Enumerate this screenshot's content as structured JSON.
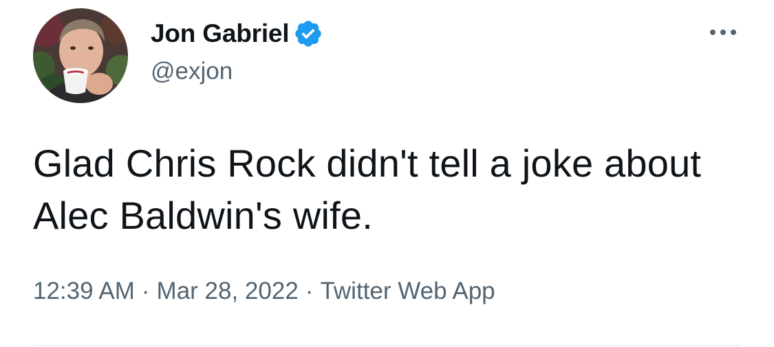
{
  "author": {
    "display_name": "Jon Gabriel",
    "handle": "@exjon",
    "verified": true
  },
  "tweet": {
    "text": "Glad Chris Rock didn't tell a joke about Alec Baldwin's wife.",
    "time": "12:39 AM",
    "date": "Mar 28, 2022",
    "separator": "·",
    "source": "Twitter Web App"
  },
  "icons": {
    "verified": "verified-badge-icon",
    "more": "more-options-icon"
  },
  "colors": {
    "primary_text": "#0f1419",
    "secondary_text": "#536471",
    "verified_blue": "#1d9bf0",
    "divider": "#eff3f4",
    "background": "#ffffff"
  }
}
